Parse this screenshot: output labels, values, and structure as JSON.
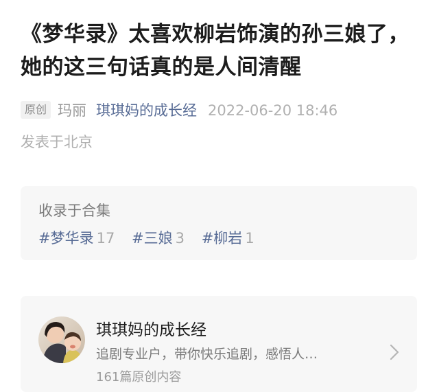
{
  "article": {
    "title": "《梦华录》太喜欢柳岩饰演的孙三娘了，她的这三句话真的是人间清醒",
    "badge": "原创",
    "author": "玛丽",
    "account": "琪琪妈的成长经",
    "date": "2022-06-20 18:46",
    "location": "发表于北京"
  },
  "collection": {
    "title": "收录于合集",
    "tags": [
      {
        "name": "#梦华录",
        "count": "17"
      },
      {
        "name": "#三娘",
        "count": "3"
      },
      {
        "name": "#柳岩",
        "count": "1"
      }
    ]
  },
  "profile": {
    "name": "琪琪妈的成长经",
    "description": "追剧专业户，带你快乐追剧，感悟人…",
    "count_text": "161篇原创内容",
    "avatar_icon": "avatar-photo",
    "chevron_icon": "chevron-right-icon"
  }
}
